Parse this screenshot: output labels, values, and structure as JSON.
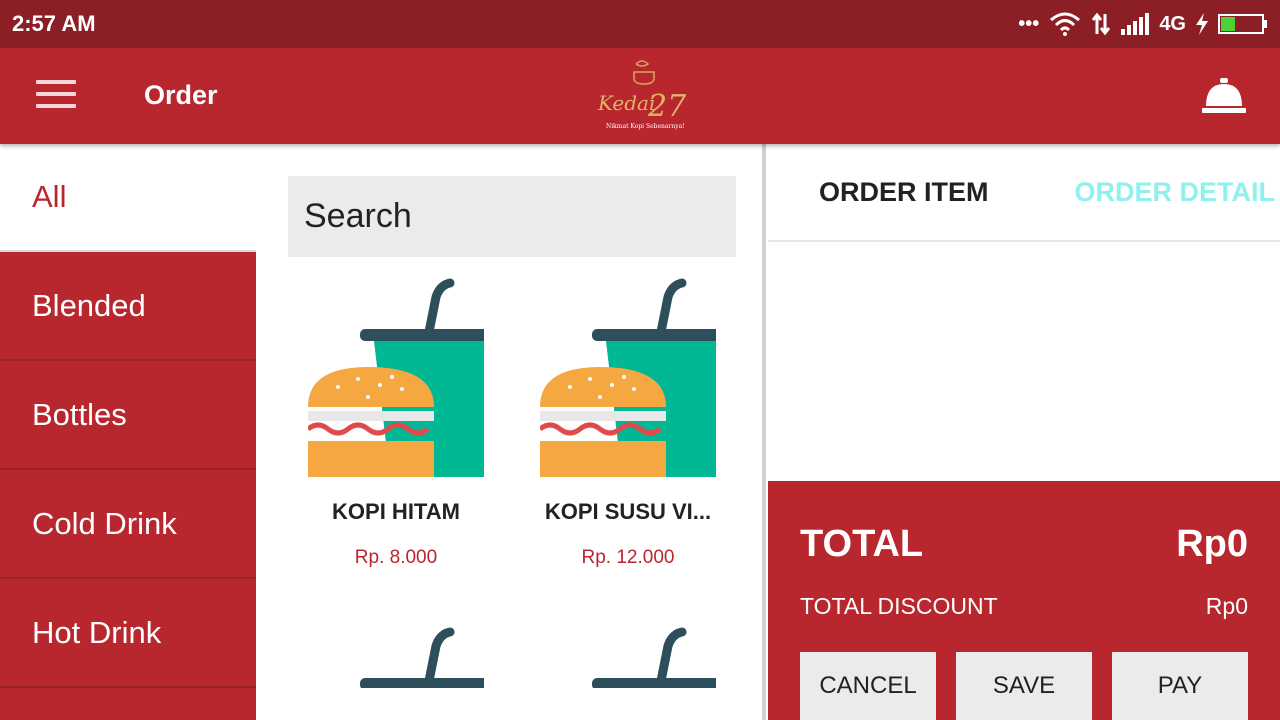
{
  "status_bar": {
    "time": "2:57 AM",
    "network": "4G",
    "icons": [
      "more-dots-icon",
      "wifi-icon",
      "data-transfer-icon",
      "signal-icon",
      "charging-icon",
      "battery-icon"
    ],
    "battery_level": 0.35
  },
  "toolbar": {
    "title": "Order",
    "logo_text": "Kedai 27",
    "logo_tagline": "Nikmat Kopi Sebenarnya!",
    "icons": [
      "menu-icon",
      "service-bell-icon"
    ]
  },
  "categories": [
    {
      "label": "All",
      "active": true
    },
    {
      "label": "Blended",
      "active": false
    },
    {
      "label": "Bottles",
      "active": false
    },
    {
      "label": "Cold Drink",
      "active": false
    },
    {
      "label": "Hot Drink",
      "active": false
    }
  ],
  "search": {
    "placeholder": "Search"
  },
  "products": [
    {
      "name": "KOPI HITAM",
      "price": "Rp. 8.000",
      "icon": "burger-drink-icon"
    },
    {
      "name": "KOPI SUSU VI...",
      "price": "Rp. 12.000",
      "icon": "burger-drink-icon"
    },
    {
      "name": "",
      "price": "",
      "icon": "burger-drink-icon"
    },
    {
      "name": "",
      "price": "",
      "icon": "burger-drink-icon"
    }
  ],
  "order": {
    "tabs": [
      "ORDER ITEM",
      "ORDER DETAIL"
    ],
    "total_label": "TOTAL",
    "total_value": "Rp0",
    "discount_label": "TOTAL DISCOUNT",
    "discount_value": "Rp0",
    "buttons": {
      "cancel": "CANCEL",
      "save": "SAVE",
      "pay": "PAY"
    }
  },
  "colors": {
    "primary": "#b8262e",
    "status_bar": "#8c1f26",
    "accent_tab": "#8ff0ee",
    "drink_cup": "#00b894",
    "burger_bun": "#f5a742"
  }
}
